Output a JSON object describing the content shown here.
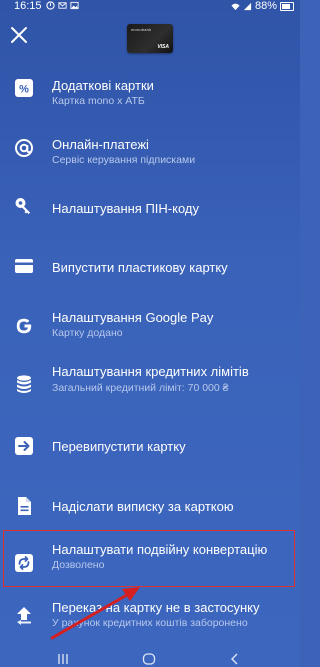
{
  "status_bar": {
    "time": "16:15",
    "battery": "88%",
    "icons": [
      "notification-icon",
      "mail-icon",
      "image-icon",
      "wifi-icon",
      "signal-icon",
      "battery-icon"
    ]
  },
  "header": {
    "close_icon": "close-icon",
    "card": {
      "brand": "monobank",
      "network": "VISA"
    }
  },
  "menu": [
    {
      "icon": "percent-icon",
      "title": "Додаткові картки",
      "subtitle": "Картка mono x АТБ"
    },
    {
      "icon": "at-icon",
      "title": "Онлайн-платежі",
      "subtitle": "Сервіс керування підписками"
    },
    {
      "icon": "key-icon",
      "title": "Налаштування ПІН-коду",
      "subtitle": ""
    },
    {
      "icon": "card-icon",
      "title": "Випустити пластикову картку",
      "subtitle": ""
    },
    {
      "icon": "google-icon",
      "title": "Налаштування Google Pay",
      "subtitle": "Картку додано"
    },
    {
      "icon": "coins-icon",
      "title": "Налаштування кредитних лімітів",
      "subtitle": "Загальний кредитний ліміт: 70 000 ₴"
    },
    {
      "icon": "reissue-icon",
      "title": "Перевипустити картку",
      "subtitle": ""
    },
    {
      "icon": "document-icon",
      "title": "Надіслати виписку за карткою",
      "subtitle": ""
    },
    {
      "icon": "conversion-icon",
      "title": "Налаштувати подвійну конвертацію",
      "subtitle": "Дозволено"
    },
    {
      "icon": "transfer-icon",
      "title": "Переказ на картку не в застосунку",
      "subtitle": "У рахунок кредитних коштів заборонено"
    }
  ],
  "colors": {
    "background": "#3d63b8",
    "subtitle": "#b7c8ec",
    "highlight": "#dd3333"
  }
}
